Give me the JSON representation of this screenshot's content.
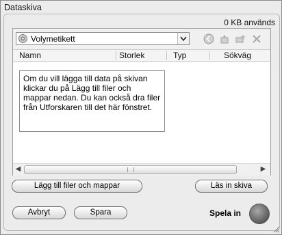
{
  "window": {
    "title": "Dataskiva"
  },
  "usage": {
    "text": "0 KB används"
  },
  "volume": {
    "label": "Volymetikett"
  },
  "columns": [
    "Namn",
    "Storlek",
    "Typ",
    "Sökväg"
  ],
  "hint": {
    "text": "Om du vill lägga till data på skivan klickar du på Lägg till filer och mappar nedan. Du kan också dra filer från Utforskaren till det här fönstret."
  },
  "buttons": {
    "add_files": "Lägg till filer och mappar",
    "read_disc": "Läs in skiva",
    "cancel": "Avbryt",
    "save": "Spara"
  },
  "record": {
    "label": "Spela in"
  },
  "icons": {
    "volume": "disc-icon",
    "back": "back-arrow-icon",
    "up": "folder-up-icon",
    "new_folder": "new-folder-icon",
    "delete": "close-icon"
  }
}
